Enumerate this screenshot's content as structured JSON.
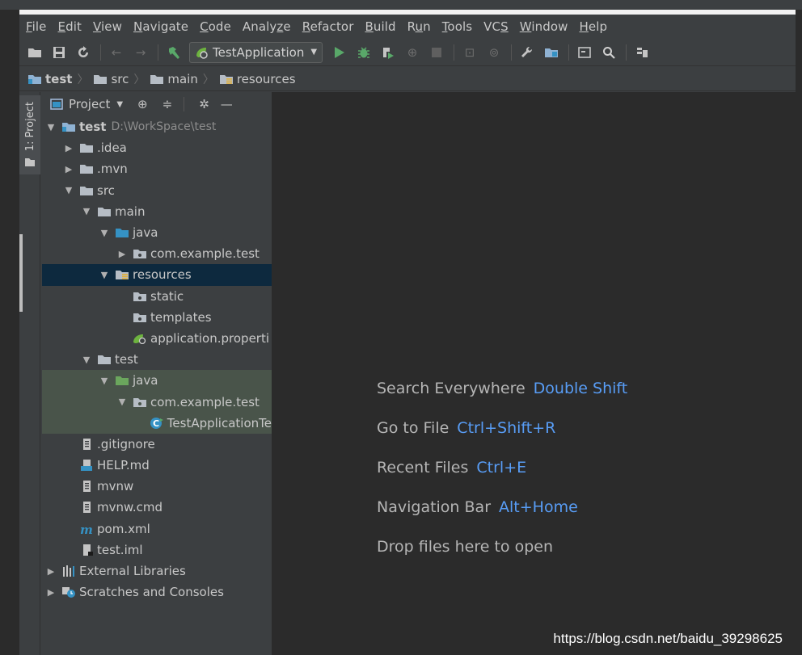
{
  "menu": {
    "items": [
      {
        "mn": "F",
        "rest": "ile"
      },
      {
        "mn": "E",
        "rest": "dit"
      },
      {
        "mn": "V",
        "rest": "iew"
      },
      {
        "mn": "N",
        "rest": "avigate"
      },
      {
        "mn": "C",
        "rest": "ode"
      },
      {
        "pre": "Analy",
        "mn": "z",
        "rest": "e"
      },
      {
        "mn": "R",
        "rest": "efactor"
      },
      {
        "mn": "B",
        "rest": "uild"
      },
      {
        "pre": "R",
        "mn": "u",
        "rest": "n"
      },
      {
        "mn": "T",
        "rest": "ools"
      },
      {
        "pre": "VC",
        "mn": "S",
        "rest": ""
      },
      {
        "mn": "W",
        "rest": "indow"
      },
      {
        "mn": "H",
        "rest": "elp"
      }
    ]
  },
  "toolbar": {
    "run_config": "TestApplication"
  },
  "breadcrumb": {
    "items": [
      "test",
      "src",
      "main",
      "resources"
    ]
  },
  "side": {
    "tab_label": "1: Project"
  },
  "project": {
    "title": "Project",
    "rows": [
      {
        "label": "test",
        "hint": "D:\\WorkSpace\\test"
      },
      {
        "label": ".idea"
      },
      {
        "label": ".mvn"
      },
      {
        "label": "src"
      },
      {
        "label": "main"
      },
      {
        "label": "java"
      },
      {
        "label": "com.example.test"
      },
      {
        "label": "resources"
      },
      {
        "label": "static"
      },
      {
        "label": "templates"
      },
      {
        "label": "application.properti"
      },
      {
        "label": "test"
      },
      {
        "label": "java"
      },
      {
        "label": "com.example.test"
      },
      {
        "label": "TestApplicationTe"
      },
      {
        "label": ".gitignore"
      },
      {
        "label": "HELP.md"
      },
      {
        "label": "mvnw"
      },
      {
        "label": "mvnw.cmd"
      },
      {
        "label": "pom.xml"
      },
      {
        "label": "test.iml"
      },
      {
        "label": "External Libraries"
      },
      {
        "label": "Scratches and Consoles"
      }
    ]
  },
  "editor": {
    "hints": [
      {
        "text": "Search Everywhere",
        "key": "Double Shift"
      },
      {
        "text": "Go to File",
        "key": "Ctrl+Shift+R"
      },
      {
        "text": "Recent Files",
        "key": "Ctrl+E"
      },
      {
        "text": "Navigation Bar",
        "key": "Alt+Home"
      },
      {
        "text": "Drop files here to open",
        "key": ""
      }
    ],
    "watermark": "https://blog.csdn.net/baidu_39298625"
  },
  "colors": {
    "accent_key": "#589df6",
    "selection": "#0d293e",
    "test_source": "#49544a",
    "run_green": "#59a869"
  }
}
